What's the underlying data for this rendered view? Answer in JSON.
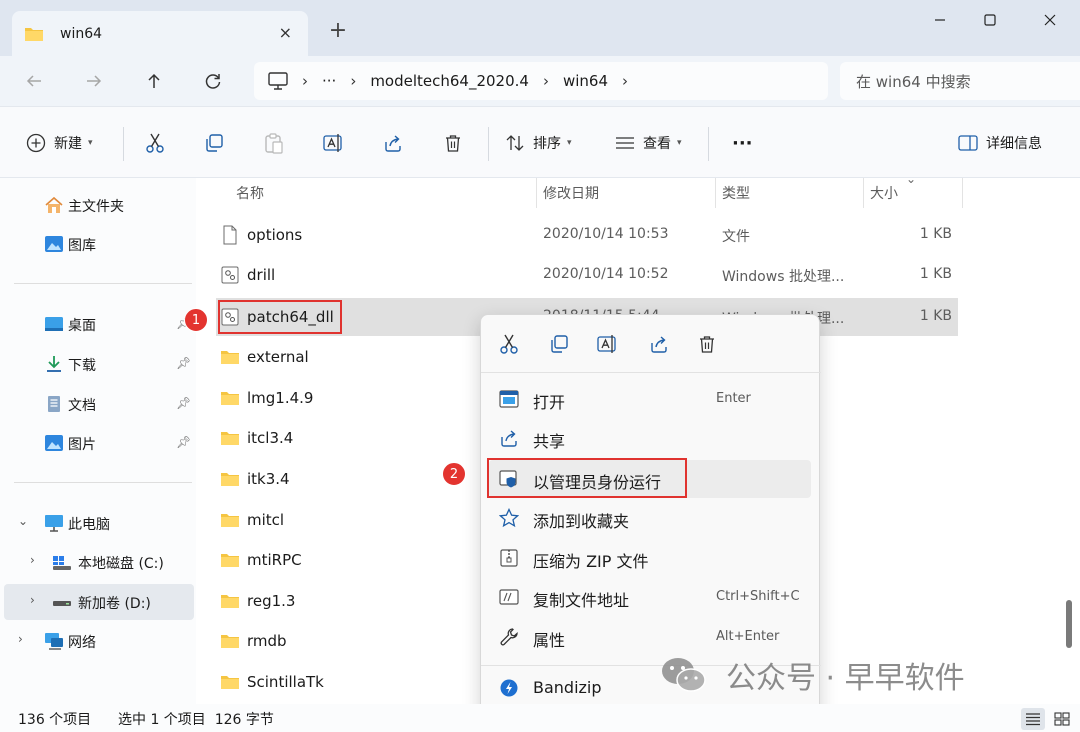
{
  "window": {
    "tab_title": "win64",
    "tab_close": "×",
    "new_tab": "+"
  },
  "address": {
    "more": "···",
    "crumbs": [
      "modeltech64_2020.4",
      "win64"
    ],
    "search_placeholder": "在 win64 中搜索"
  },
  "toolbar": {
    "new_label": "新建",
    "sort_label": "排序",
    "view_label": "查看",
    "more_label": "···",
    "details_label": "详细信息"
  },
  "sidebar": {
    "items": [
      {
        "label": "主文件夹"
      },
      {
        "label": "图库"
      },
      {
        "label": "桌面"
      },
      {
        "label": "下载"
      },
      {
        "label": "文档"
      },
      {
        "label": "图片"
      },
      {
        "label": "此电脑"
      },
      {
        "label": "本地磁盘 (C:)"
      },
      {
        "label": "新加卷 (D:)"
      },
      {
        "label": "网络"
      }
    ]
  },
  "columns": {
    "name": "名称",
    "modified": "修改日期",
    "type": "类型",
    "size": "大小"
  },
  "files": [
    {
      "name": "options",
      "date": "2020/10/14 10:53",
      "type": "文件",
      "size": "1 KB"
    },
    {
      "name": "drill",
      "date": "2020/10/14 10:52",
      "type": "Windows 批处理...",
      "size": "1 KB"
    },
    {
      "name": "patch64_dll",
      "date": "2018/11/15 5:44",
      "type": "Windows 批处理...",
      "size": "1 KB"
    },
    {
      "name": "external"
    },
    {
      "name": "lmg1.4.9"
    },
    {
      "name": "itcl3.4"
    },
    {
      "name": "itk3.4"
    },
    {
      "name": "mitcl"
    },
    {
      "name": "mtiRPC"
    },
    {
      "name": "reg1.3"
    },
    {
      "name": "rmdb"
    },
    {
      "name": "ScintillaTk"
    }
  ],
  "context_menu": {
    "items": [
      {
        "label": "打开",
        "shortcut": "Enter"
      },
      {
        "label": "共享",
        "shortcut": ""
      },
      {
        "label": "以管理员身份运行",
        "shortcut": ""
      },
      {
        "label": "添加到收藏夹",
        "shortcut": ""
      },
      {
        "label": "压缩为 ZIP 文件",
        "shortcut": ""
      },
      {
        "label": "复制文件地址",
        "shortcut": "Ctrl+Shift+C"
      },
      {
        "label": "属性",
        "shortcut": "Alt+Enter"
      },
      {
        "label": "Bandizip",
        "shortcut": ""
      }
    ]
  },
  "annotations": {
    "badge1": "1",
    "badge2": "2"
  },
  "status": {
    "count": "136 个项目",
    "selected": "选中 1 个项目  126 字节"
  },
  "watermark": {
    "text": "公众号 · 早早软件"
  },
  "colors": {
    "accent": "#0067c0",
    "highlight": "#e0332f",
    "folder": "#f5c542"
  }
}
